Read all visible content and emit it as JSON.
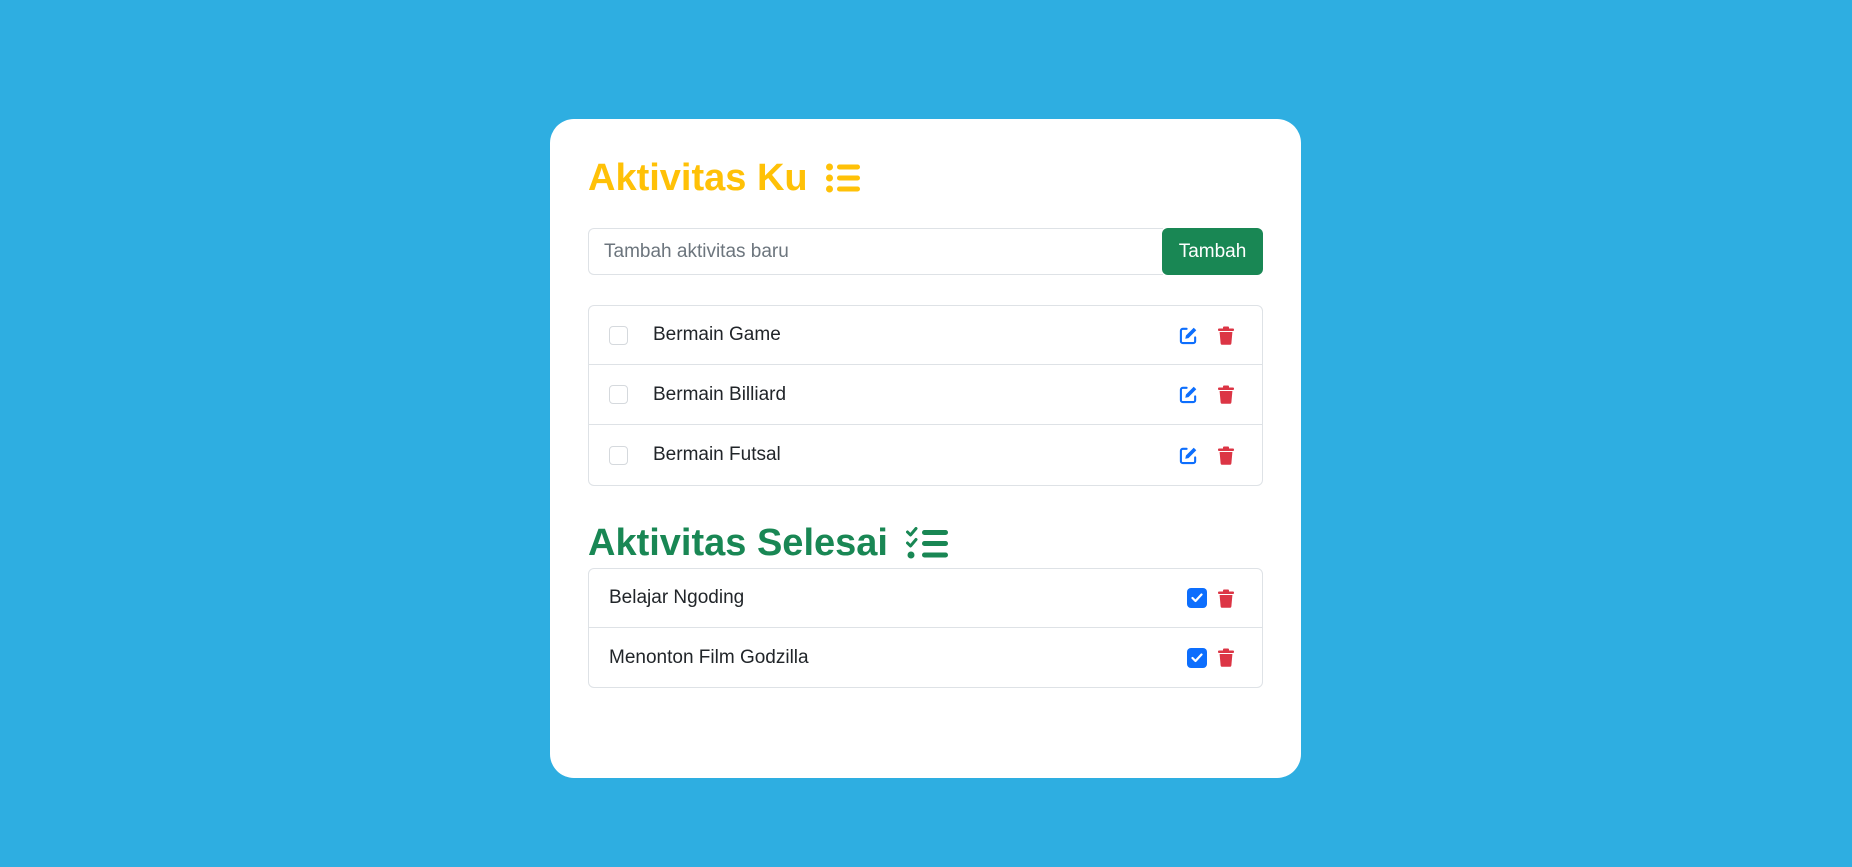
{
  "colors": {
    "background": "#2eaee1",
    "card": "#ffffff",
    "heading_todo": "#ffc107",
    "heading_done": "#198754",
    "add_button": "#198754",
    "edit_icon": "#0d6efd",
    "delete_icon": "#dc3545",
    "checkbox_checked": "#0d6efd"
  },
  "todo_section": {
    "title": "Aktivitas Ku",
    "icon": "list-icon",
    "input": {
      "placeholder": "Tambah aktivitas baru",
      "value": ""
    },
    "add_button_label": "Tambah",
    "items": [
      {
        "label": "Bermain Game",
        "checked": false
      },
      {
        "label": "Bermain Billiard",
        "checked": false
      },
      {
        "label": "Bermain Futsal",
        "checked": false
      }
    ]
  },
  "done_section": {
    "title": "Aktivitas Selesai",
    "icon": "list-check-icon",
    "items": [
      {
        "label": "Belajar Ngoding",
        "checked": true
      },
      {
        "label": "Menonton Film Godzilla",
        "checked": true
      }
    ]
  }
}
